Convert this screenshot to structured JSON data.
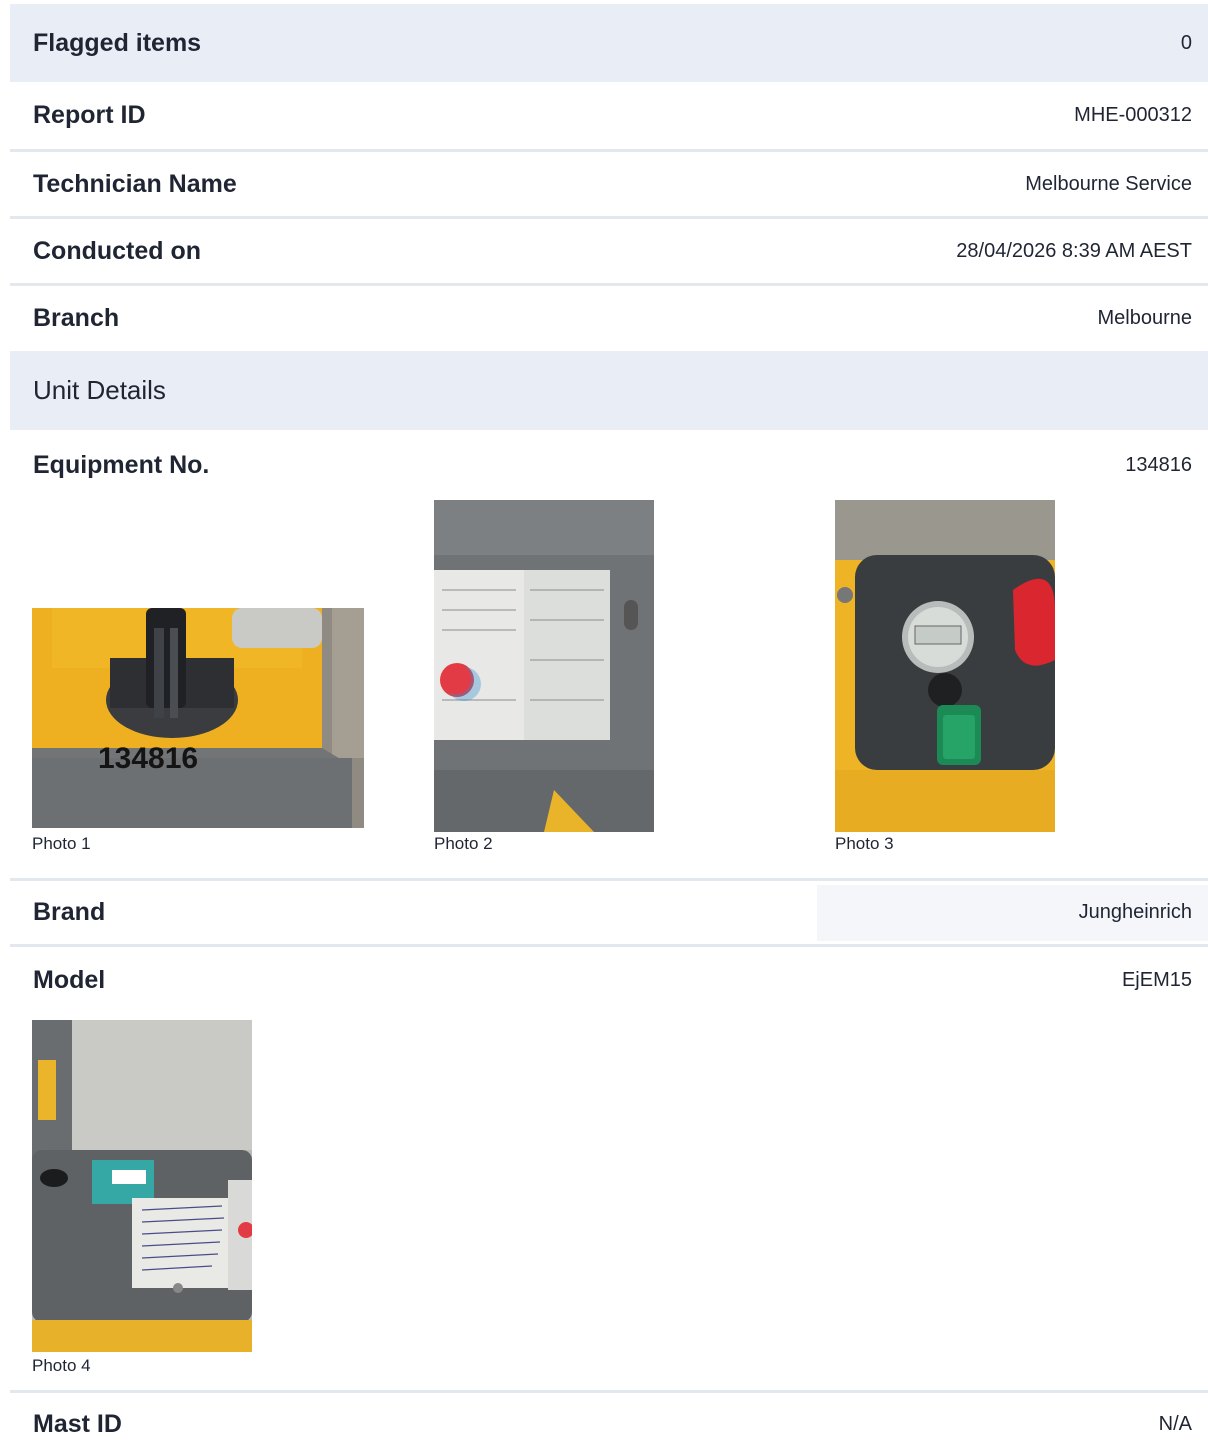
{
  "report": {
    "flagged": {
      "label": "Flagged items",
      "value": "0"
    },
    "report_id": {
      "label": "Report ID",
      "value": "MHE-000312"
    },
    "technician": {
      "label": "Technician Name",
      "value": "Melbourne Service"
    },
    "conducted": {
      "label": "Conducted on",
      "value": "28/04/2026 8:39 AM AEST"
    },
    "branch": {
      "label": "Branch",
      "value": "Melbourne"
    }
  },
  "unit_details": {
    "title": "Unit Details",
    "equipment": {
      "label": "Equipment No.",
      "value": "134816"
    },
    "equipment_photos": [
      {
        "caption": "Photo 1",
        "plate_text": "134816"
      },
      {
        "caption": "Photo 2"
      },
      {
        "caption": "Photo 3"
      }
    ],
    "brand": {
      "label": "Brand",
      "value": "Jungheinrich"
    },
    "model": {
      "label": "Model",
      "value": "EjEM15"
    },
    "model_photos": [
      {
        "caption": "Photo 4"
      }
    ],
    "mast": {
      "label": "Mast ID",
      "value": "N/A"
    }
  },
  "colors": {
    "header_band": "#e9edf6",
    "divider": "#e3e7ee",
    "brand_highlight": "#f4f6fa",
    "truck_yellow": "#f2b41e",
    "truck_grey": "#6b6e70"
  }
}
